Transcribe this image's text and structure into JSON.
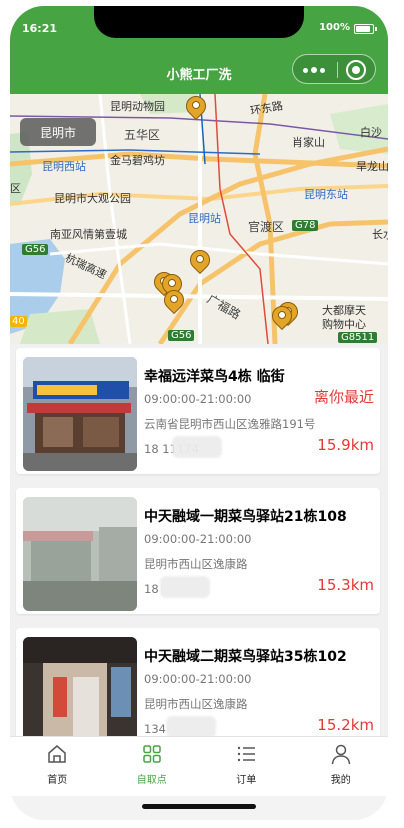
{
  "status": {
    "time": "16:21",
    "battery": "100%"
  },
  "nav": {
    "title": "小熊工厂洗"
  },
  "map": {
    "city_chip": "昆明市",
    "labels": [
      "昆明动物园",
      "五华区",
      "环东路",
      "肖家山",
      "白沙",
      "昆明西站",
      "金马碧鸡坊",
      "旱龙山",
      "区",
      "昆明市大观公园",
      "昆明东站",
      "昆明站",
      "官渡区",
      "G78",
      "长水",
      "南亚风情第壹城",
      "G56",
      "杭瑞高速",
      "广福路",
      "大都摩天",
      "购物中心",
      "G56",
      "G8511",
      "40"
    ]
  },
  "stores": [
    {
      "name": "幸福远洋菜鸟4栋 临街",
      "hours": "09:00:00-21:00:00",
      "tag": "离你最近",
      "address": "云南省昆明市西山区逸雅路191号",
      "phone": "18      11174",
      "distance": "15.9km"
    },
    {
      "name": "中天融域一期菜鸟驿站21栋108",
      "hours": "09:00:00-21:00:00",
      "tag": "",
      "address": "昆明市西山区逸康路",
      "phone": "18",
      "distance": "15.3km"
    },
    {
      "name": "中天融域二期菜鸟驿站35栋102",
      "hours": "09:00:00-21:00:00",
      "tag": "",
      "address": "昆明市西山区逸康路",
      "phone": "134",
      "distance": "15.2km"
    }
  ],
  "tabs": [
    {
      "label": "首页",
      "icon": "home-icon"
    },
    {
      "label": "自取点",
      "icon": "grid-icon"
    },
    {
      "label": "订单",
      "icon": "list-icon"
    },
    {
      "label": "我的",
      "icon": "user-icon"
    }
  ],
  "colors": {
    "brand": "#46a442",
    "price": "#e53935",
    "pin": "#e3a527"
  }
}
